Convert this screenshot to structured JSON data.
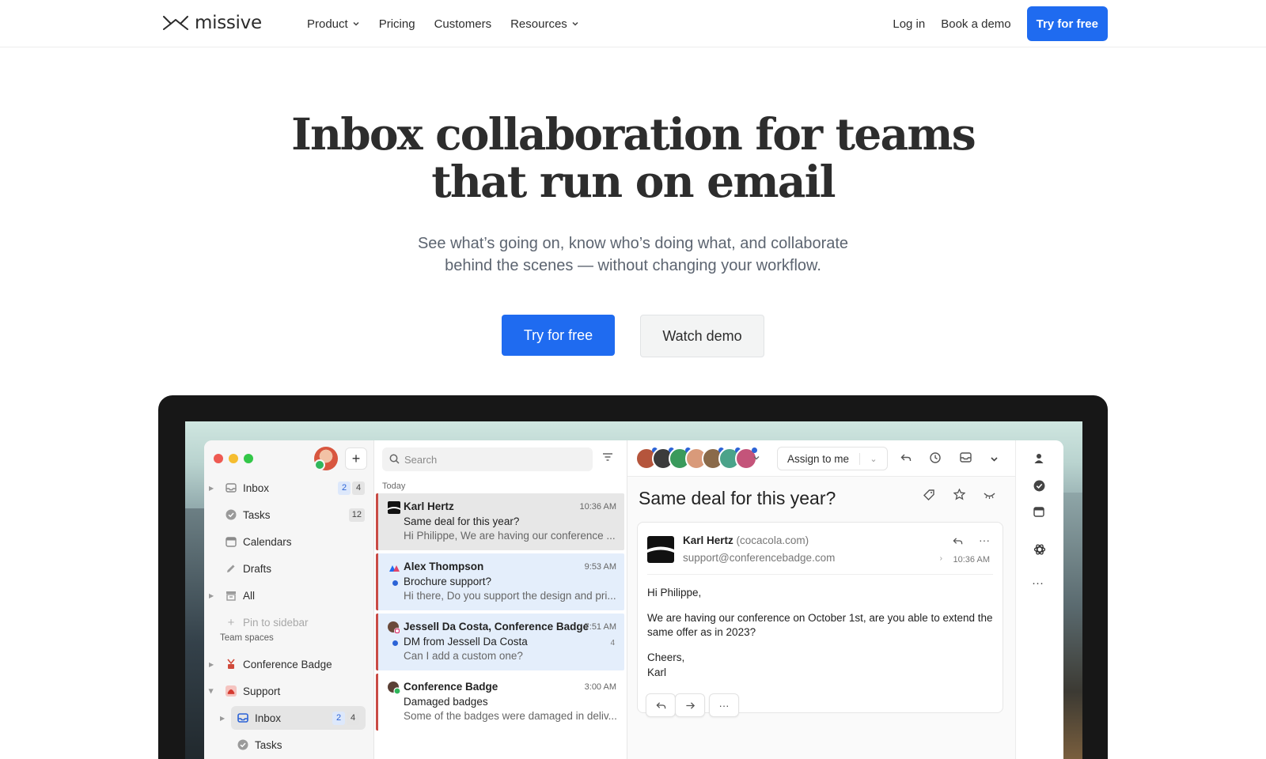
{
  "nav": {
    "logo_text": "missive",
    "links": [
      {
        "label": "Product",
        "has_dropdown": true
      },
      {
        "label": "Pricing",
        "has_dropdown": false
      },
      {
        "label": "Customers",
        "has_dropdown": false
      },
      {
        "label": "Resources",
        "has_dropdown": true
      }
    ],
    "login": "Log in",
    "book_demo": "Book a demo",
    "try_free": "Try for free"
  },
  "hero": {
    "title_line1": "Inbox collaboration for teams",
    "title_line2": "that run on email",
    "subtitle_line1": "See what’s going on, know who’s doing what, and collaborate",
    "subtitle_line2": "behind the scenes — without changing your workflow.",
    "cta_primary": "Try for free",
    "cta_secondary": "Watch demo"
  },
  "app": {
    "sidebar": {
      "items": [
        {
          "label": "Inbox",
          "badge_blue": "2",
          "badge_gray": "4",
          "icon": "inbox-icon"
        },
        {
          "label": "Tasks",
          "badge_gray": "12",
          "icon": "check-circle-icon"
        },
        {
          "label": "Calendars",
          "icon": "calendar-icon"
        },
        {
          "label": "Drafts",
          "icon": "pencil-icon"
        },
        {
          "label": "All",
          "icon": "archive-icon"
        },
        {
          "label": "Pin to sidebar",
          "icon": "plus-icon"
        }
      ],
      "team_heading": "Team spaces",
      "teams": [
        {
          "label": "Conference Badge",
          "icon": "conference-badge-logo"
        },
        {
          "label": "Support",
          "icon": "support-logo"
        }
      ],
      "sub_items": [
        {
          "label": "Inbox",
          "badge_blue": "2",
          "badge_gray": "4",
          "icon": "inbox-icon"
        },
        {
          "label": "Tasks",
          "icon": "check-circle-icon"
        }
      ]
    },
    "list": {
      "search_placeholder": "Search",
      "section": "Today",
      "conversations": [
        {
          "from": "Karl Hertz",
          "time": "10:36 AM",
          "subject": "Same deal for this year?",
          "preview": "Hi Philippe, We are having our conference ...",
          "state": "selected"
        },
        {
          "from": "Alex Thompson",
          "time": "9:53 AM",
          "subject": "Brochure support?",
          "preview": "Hi there, Do you support the design and pri...",
          "state": "unread"
        },
        {
          "from": "Jessell Da Costa, Conference Badge",
          "time": "7:51 AM",
          "subject": "DM from Jessell Da Costa",
          "preview": "Can I add a custom one?",
          "count": "4",
          "state": "unread"
        },
        {
          "from": "Conference Badge",
          "time": "3:00 AM",
          "subject": "Damaged badges",
          "preview": "Some of the badges were damaged in deliv...",
          "state": "read"
        }
      ]
    },
    "reader": {
      "assign_label": "Assign to me",
      "title": "Same deal for this year?",
      "sender_name": "Karl Hertz",
      "sender_domain": "(cocacola.com)",
      "sender_address": "support@conferencebadge.com",
      "time": "10:36 AM",
      "body": [
        "Hi Philippe,",
        "We are having our conference on October 1st, are you able to extend the same offer as in 2023?",
        "Cheers,",
        "Karl"
      ],
      "more_label": "···"
    },
    "rail": {
      "icons": [
        "person-icon",
        "check-circle-icon",
        "calendar-icon",
        "openai-icon",
        "more-icon"
      ]
    }
  },
  "colors": {
    "brand_blue": "#1f6bf0",
    "unread_dot": "#2c63d6",
    "stripe_red": "#c94b45"
  }
}
